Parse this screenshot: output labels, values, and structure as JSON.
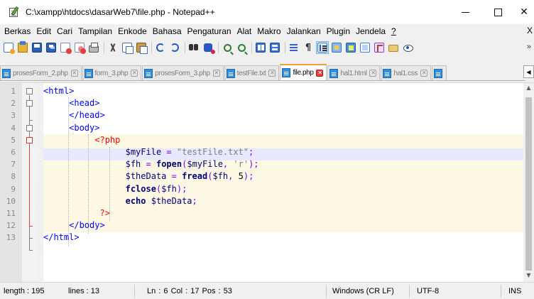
{
  "window": {
    "title": "C:\\xampp\\htdocs\\dasarWeb7\\file.php - Notepad++",
    "minimize_glyph": "—",
    "maximize_glyph": "☐",
    "close_glyph": "✕"
  },
  "menu": {
    "items": [
      "Berkas",
      "Edit",
      "Cari",
      "Tampilan",
      "Enkode",
      "Bahasa",
      "Pengaturan",
      "Alat",
      "Makro",
      "Jalankan",
      "Plugin",
      "Jendela"
    ],
    "help": "?",
    "overflow": "X"
  },
  "toolbar": {
    "icons": [
      "new-file-icon",
      "open-file-icon",
      "save-icon",
      "save-all-icon",
      "close-icon",
      "close-all-icon",
      "print-icon",
      "cut-icon",
      "copy-icon",
      "paste-icon",
      "undo-icon",
      "redo-icon",
      "find-icon",
      "replace-icon",
      "zoom-in-icon",
      "zoom-out-icon",
      "sync-vertical-icon",
      "sync-horizontal-icon",
      "word-wrap-icon",
      "show-all-characters-icon",
      "indent-guide-icon",
      "user-defined-language-icon",
      "document-map-icon",
      "document-list-icon",
      "function-list-icon",
      "folder-as-workspace-icon",
      "monitoring-icon"
    ],
    "pilcrow": "¶",
    "overflow": "»"
  },
  "tabs": [
    {
      "label": "prosesForm_2.php",
      "active": false
    },
    {
      "label": "form_3.php",
      "active": false
    },
    {
      "label": "prosesForm_3.php",
      "active": false
    },
    {
      "label": "testFile.txt",
      "active": false
    },
    {
      "label": "file.php",
      "active": true
    },
    {
      "label": "hal1.html",
      "active": false
    },
    {
      "label": "hal1.css",
      "active": false
    }
  ],
  "tab_close_glyph": "✕",
  "tab_scroll_glyph": "◀",
  "editor": {
    "line_numbers": [
      "1",
      "2",
      "3",
      "4",
      "5",
      "6",
      "7",
      "8",
      "9",
      "10",
      "11",
      "12",
      "13"
    ],
    "current_line": 6,
    "code": {
      "l1_tag": "<html>",
      "l2_tag": "<head>",
      "l3_tag": "</head>",
      "l4_tag": "<body>",
      "l5_php_open": "<?php",
      "l6_var": "$myFile",
      "l6_op": "=",
      "l6_str": "\"testFile.txt\"",
      "l6_end": ";",
      "l7_var": "$fh",
      "l7_op": "=",
      "l7_fn": "fopen",
      "l7_args_open": "(",
      "l7_arg1": "$myFile",
      "l7_comma": ",",
      "l7_arg2": "'r'",
      "l7_close": ");",
      "l8_var": "$theData",
      "l8_op": "=",
      "l8_fn": "fread",
      "l8_args_open": "(",
      "l8_arg1": "$fh",
      "l8_comma": ",",
      "l8_arg2": "5",
      "l8_close": ");",
      "l9_fn": "fclose",
      "l9_args_open": "(",
      "l9_arg1": "$fh",
      "l9_close": ");",
      "l10_kw": "echo",
      "l10_var": "$theData",
      "l10_end": ";",
      "l11_php_close": "?>",
      "l12_tag": "</body>",
      "l13_tag": "</html>"
    },
    "scroll_up": "▲",
    "scroll_down": "▼"
  },
  "status": {
    "length": "length : 195",
    "lines": "lines : 13",
    "position": "Ln : 6   Col : 17   Pos : 53",
    "eol": "Windows (CR LF)",
    "encoding": "UTF-8",
    "mode": "INS"
  },
  "colors": {
    "accent_tab": "#f1a132",
    "html_tag": "#0000ff",
    "php_tag": "#ff0000",
    "variable": "#000080",
    "string": "#808080",
    "operator": "#8000ff",
    "current_line_bg": "#e8e8ff",
    "php_block_bg": "#fdf8e3"
  }
}
